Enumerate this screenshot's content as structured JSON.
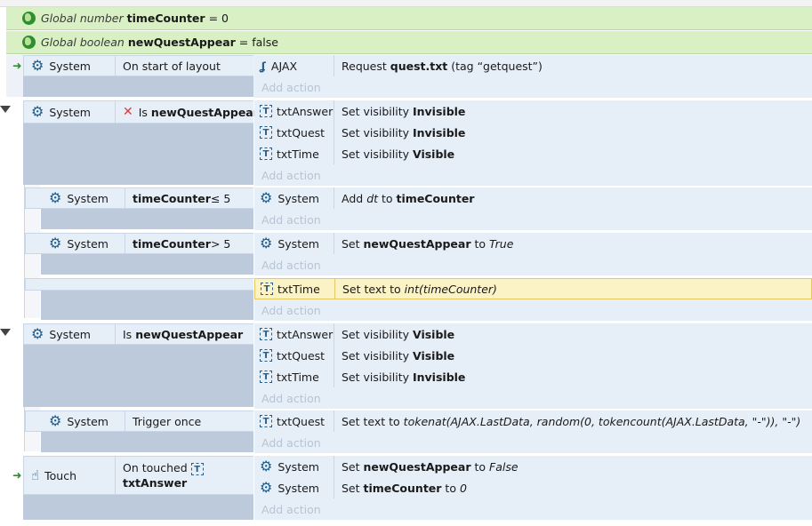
{
  "globals": [
    {
      "prefix": "Global number",
      "name": "timeCounter",
      "value": "= 0"
    },
    {
      "prefix": "Global boolean",
      "name": "newQuestAppear",
      "value": "= false"
    }
  ],
  "add_action": "Add action",
  "events": {
    "e1": {
      "obj": "System",
      "cond": "On start of layout",
      "actions": [
        {
          "obj": "AJAX",
          "text": "Request ",
          "bold": "quest.txt",
          "rest": " (tag “getquest”)"
        }
      ]
    },
    "e2": {
      "obj": "System",
      "cond_prefix": "Is ",
      "cond_bold": "newQuestAppear",
      "actions": [
        {
          "obj": "txtAnswer",
          "text": "Set visibility ",
          "bold": "Invisible"
        },
        {
          "obj": "txtQuest",
          "text": "Set visibility ",
          "bold": "Invisible"
        },
        {
          "obj": "txtTime",
          "text": "Set visibility ",
          "bold": "Visible"
        }
      ]
    },
    "e3": {
      "obj": "System",
      "cond_bold": "timeCounter",
      "cond_rest": " ≤ 5",
      "actions": [
        {
          "obj": "System",
          "text": "Add ",
          "ital": "dt",
          "mid": " to ",
          "bold": "timeCounter"
        }
      ]
    },
    "e4": {
      "obj": "System",
      "cond_bold": "timeCounter",
      "cond_rest": " > 5",
      "actions": [
        {
          "obj": "System",
          "text": "Set ",
          "bold": "newQuestAppear",
          "mid": " to ",
          "ital": "True"
        }
      ]
    },
    "e5": {
      "actions": [
        {
          "obj": "txtTime",
          "text": "Set text to ",
          "ital": "int(timeCounter)"
        }
      ]
    },
    "e6": {
      "obj": "System",
      "cond_prefix": "Is ",
      "cond_bold": "newQuestAppear",
      "actions": [
        {
          "obj": "txtAnswer",
          "text": "Set visibility ",
          "bold": "Visible"
        },
        {
          "obj": "txtQuest",
          "text": "Set visibility ",
          "bold": "Visible"
        },
        {
          "obj": "txtTime",
          "text": "Set visibility ",
          "bold": "Invisible"
        }
      ]
    },
    "e7": {
      "obj": "System",
      "cond": "Trigger once",
      "actions": [
        {
          "obj": "txtQuest",
          "text": "Set text to ",
          "ital": "tokenat(AJAX.LastData, random(0, tokencount(AJAX.LastData, \"-\")), \"-\")"
        }
      ]
    },
    "e8": {
      "obj": "Touch",
      "cond": "On touched",
      "cond_bold": "txtAnswer",
      "actions": [
        {
          "obj": "System",
          "text": "Set ",
          "bold": "newQuestAppear",
          "mid": " to ",
          "ital": "False"
        },
        {
          "obj": "System",
          "text": "Set ",
          "bold": "timeCounter",
          "mid": " to ",
          "ital": "0"
        }
      ]
    }
  }
}
